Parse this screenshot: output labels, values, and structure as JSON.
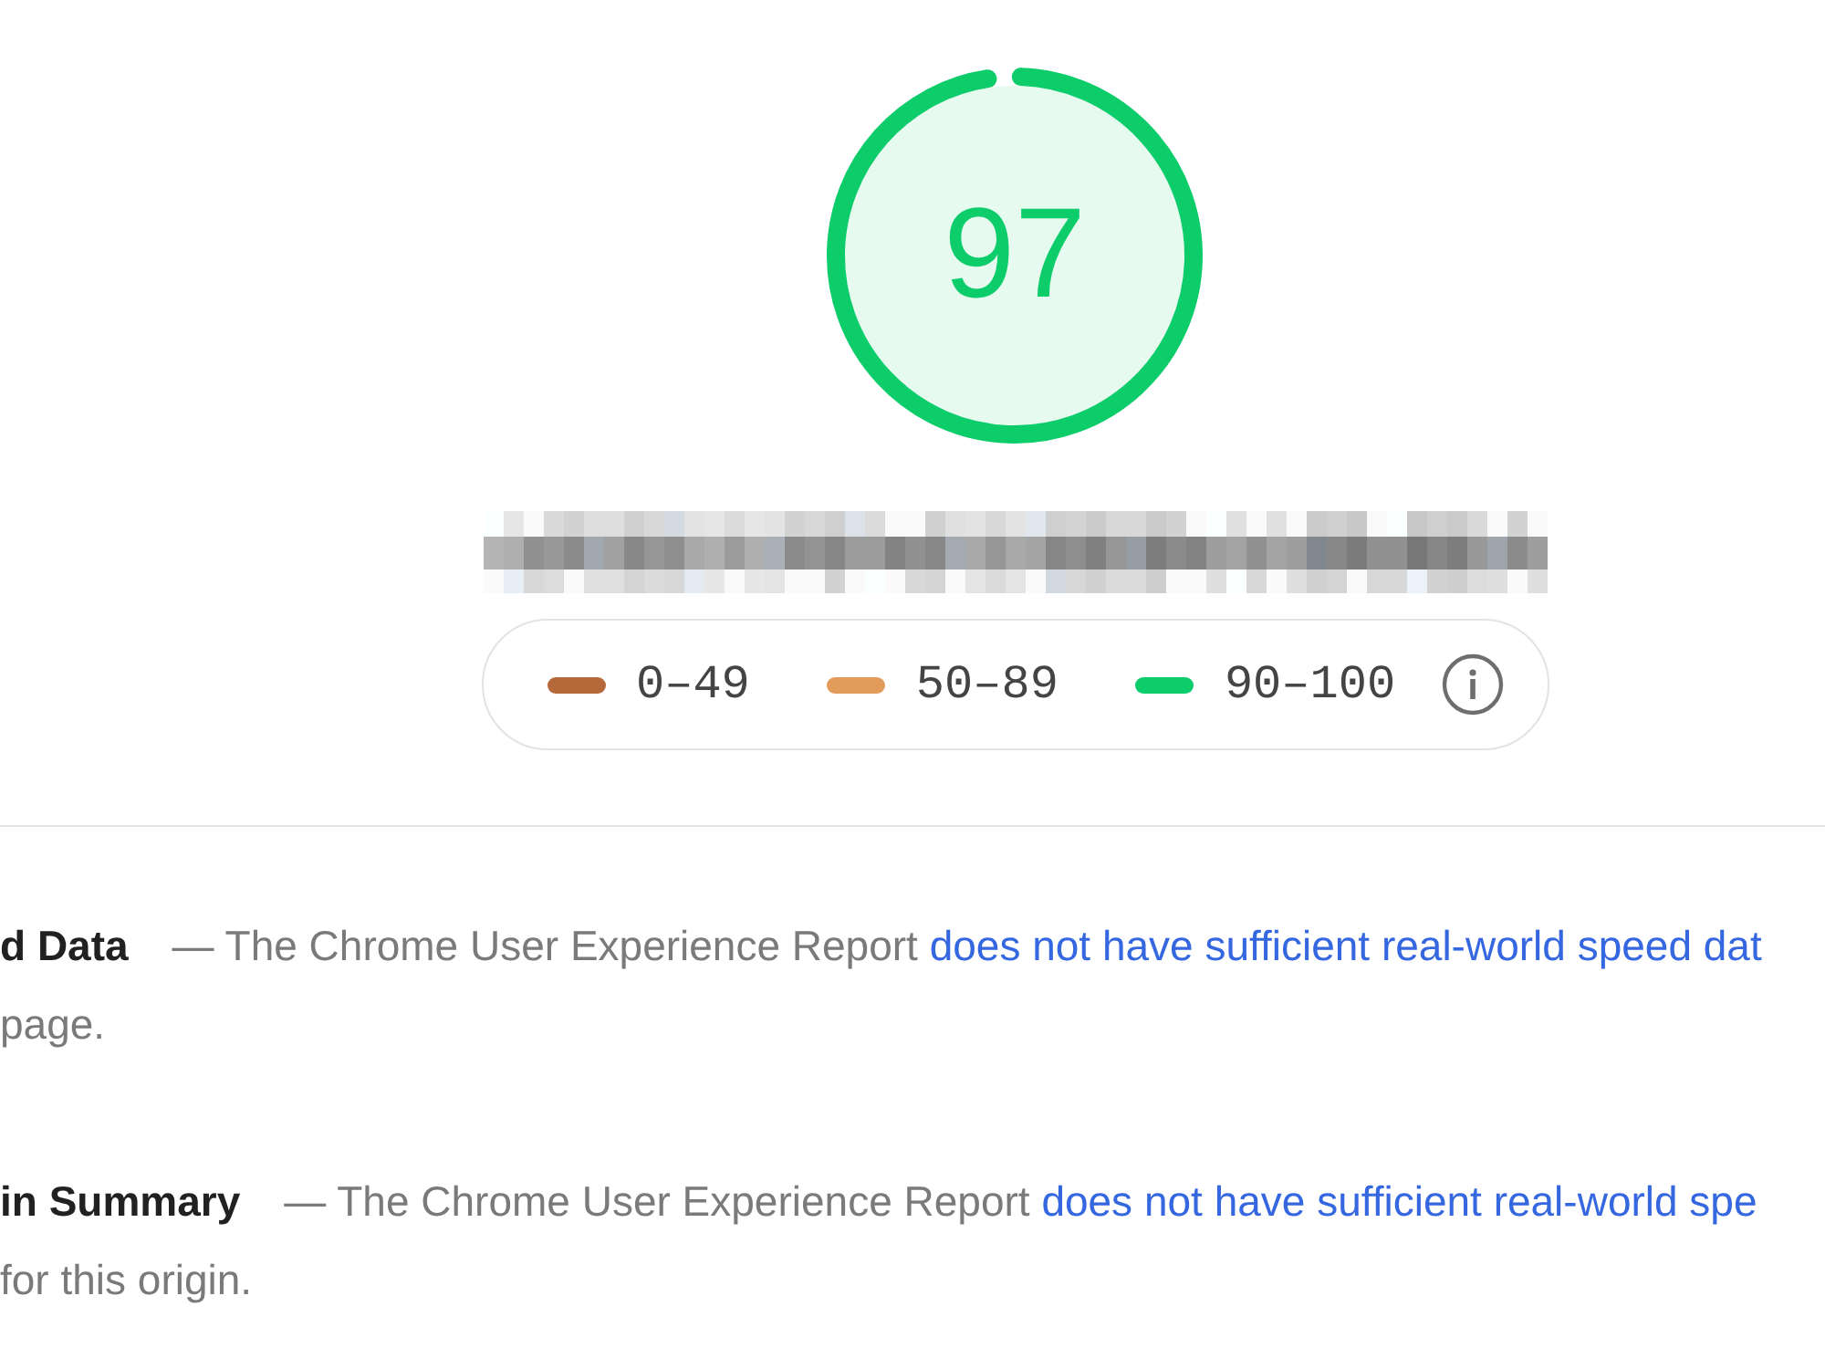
{
  "gauge": {
    "score": "97",
    "level": 0.97
  },
  "url": {
    "redacted": true
  },
  "legend": {
    "ranges": [
      {
        "label": "0–49",
        "color": "#b5693a"
      },
      {
        "label": "50–89",
        "color": "#e39b5c"
      },
      {
        "label": "90–100",
        "color": "#0ccd6a"
      }
    ]
  },
  "sections": [
    {
      "title": "d Data",
      "description": "— The Chrome User Experience Report",
      "link": "does not have sufficient real-world speed dat",
      "continuation": "page."
    },
    {
      "title": "in Summary",
      "description": "— The Chrome User Experience Report",
      "link": "does not have sufficient real-world spe",
      "continuation": "for this origin."
    }
  ]
}
